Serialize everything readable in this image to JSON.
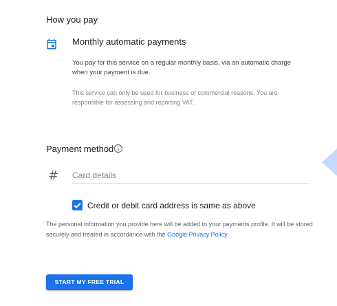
{
  "how_you_pay": {
    "title": "How you pay",
    "plan_title": "Monthly automatic payments",
    "plan_description": "You pay for this service on a regular monthly basis, via an automatic charge when your payment is due.",
    "plan_note": "This service can only be used for business or commercial reasons. You are responsible for assessing and reporting VAT.",
    "icon": "calendar-icon"
  },
  "payment_method": {
    "title": "Payment method",
    "info_icon": "info-icon",
    "card_icon": "hash-icon",
    "card_placeholder": "Card details",
    "checkbox_checked": true,
    "checkbox_label": "Credit or debit card address is same as above"
  },
  "privacy": {
    "text_before_link": "The personal information you provide here will be added to your payments profile. It will be stored securely and treated in accordance with the ",
    "link_text": "Google Privacy Policy",
    "text_after_link": "."
  },
  "cta": {
    "label": "START MY FREE TRIAL"
  },
  "colors": {
    "accent": "#1a73e8",
    "side_tab": "#c6dafc"
  }
}
